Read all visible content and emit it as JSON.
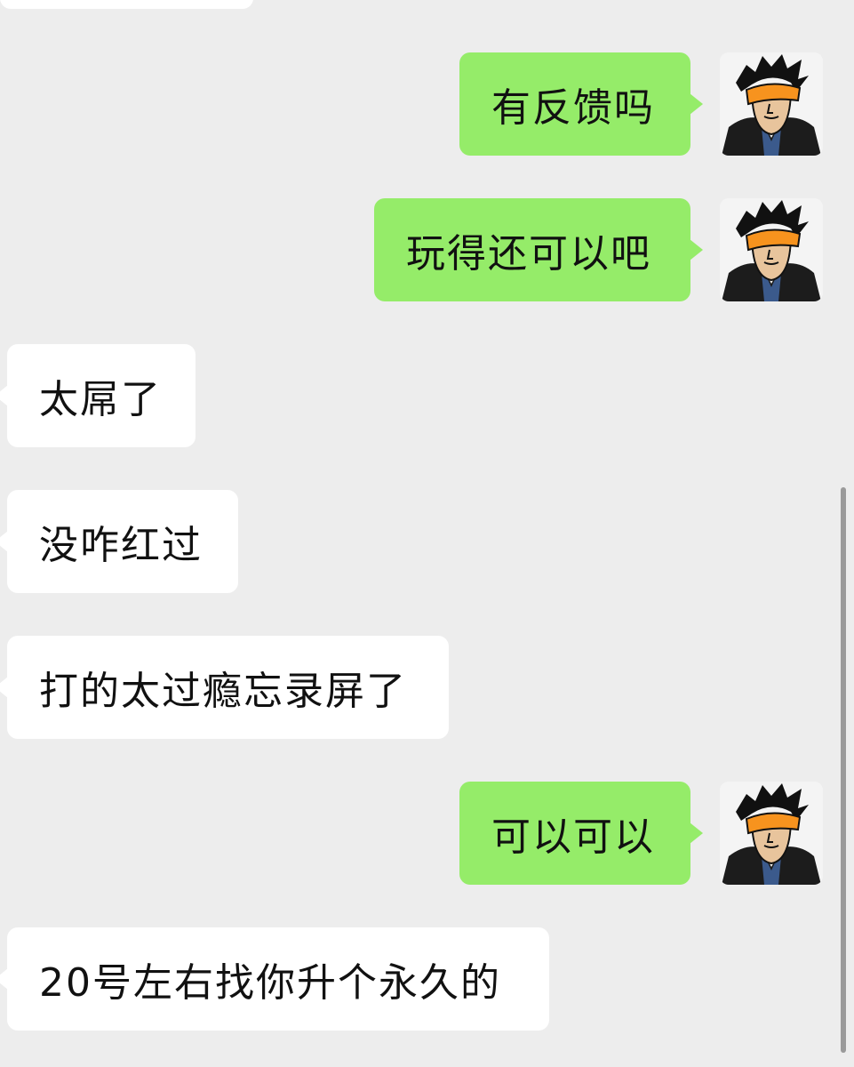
{
  "messages": [
    {
      "sender": "me",
      "text": "有反馈吗"
    },
    {
      "sender": "me",
      "text": "玩得还可以吧"
    },
    {
      "sender": "other",
      "text": "太屌了"
    },
    {
      "sender": "other",
      "text": "没咋红过"
    },
    {
      "sender": "other",
      "text": "打的太过瘾忘录屏了"
    },
    {
      "sender": "me",
      "text": "可以可以"
    },
    {
      "sender": "other",
      "text": "20号左右找你升个永久的"
    }
  ],
  "avatar": {
    "icon": "cartoon-avatar-icon",
    "visor_color": "#f7931e"
  },
  "colors": {
    "background": "#ededed",
    "outgoing_bubble": "#95ec69",
    "incoming_bubble": "#ffffff"
  }
}
